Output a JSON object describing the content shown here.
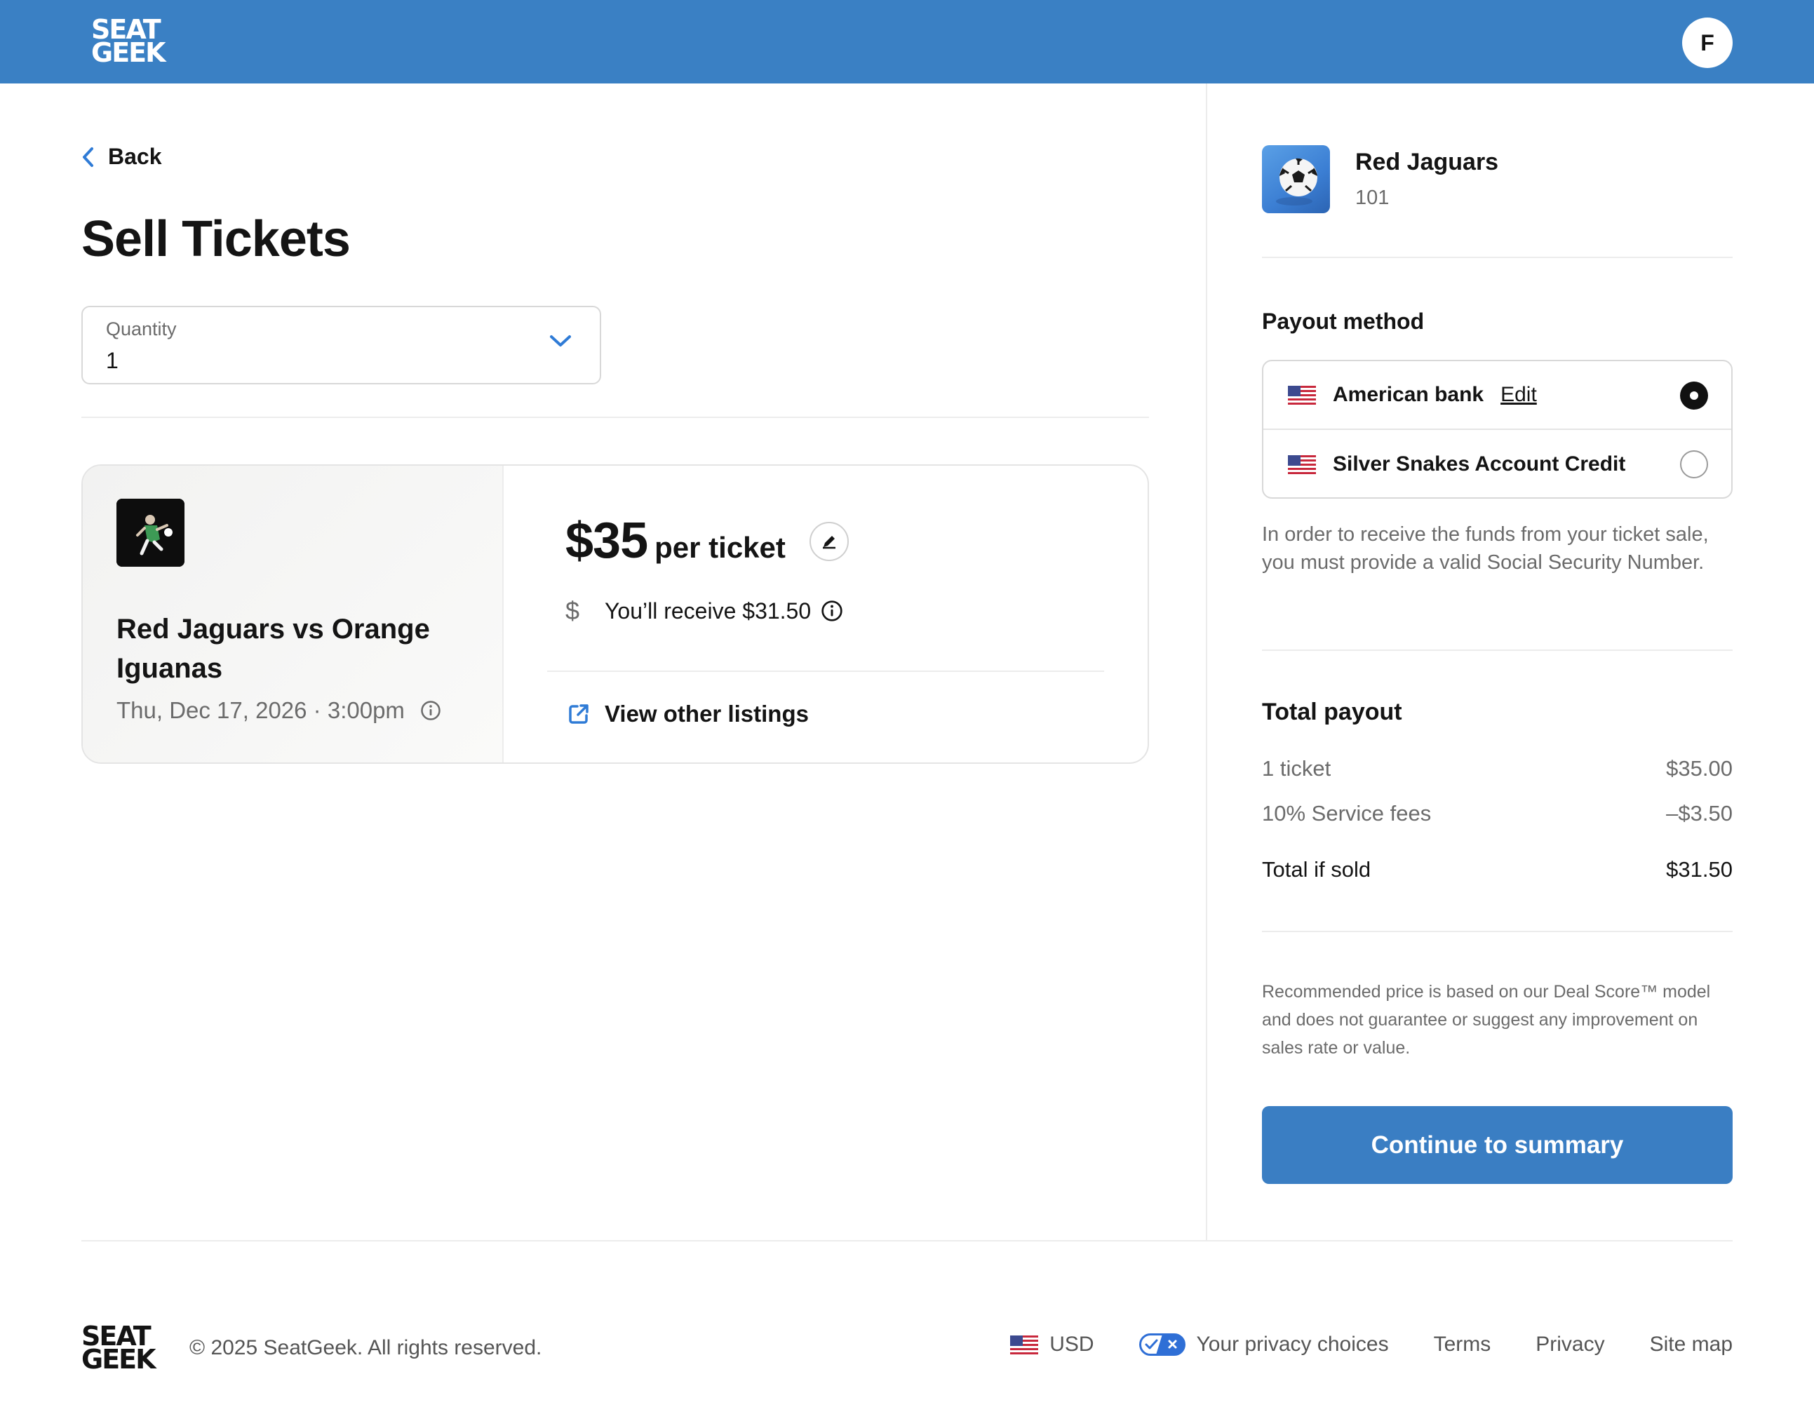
{
  "header": {
    "logo": "SEAT GEEK",
    "avatar_initial": "F"
  },
  "main": {
    "back_label": "Back",
    "title": "Sell Tickets",
    "quantity": {
      "label": "Quantity",
      "value": "1"
    },
    "event": {
      "title": "Red Jaguars vs Orange Iguanas",
      "date": "Thu, Dec 17, 2026 · 3:00pm"
    },
    "price": {
      "amount": "$35",
      "unit": "per ticket",
      "receive_text": "You’ll receive $31.50"
    },
    "view_other_listings": "View other listings"
  },
  "sidebar": {
    "team_name": "Red Jaguars",
    "section": "101",
    "payout_title": "Payout method",
    "payout_options": [
      {
        "label": "American bank",
        "edit_label": "Edit",
        "selected": true
      },
      {
        "label": "Silver Snakes Account Credit",
        "selected": false
      }
    ],
    "ssn_note": "In order to receive the funds from your ticket sale, you must provide a valid Social Security Number.",
    "total": {
      "title": "Total payout",
      "rows": [
        {
          "label": "1 ticket",
          "value": "$35.00"
        },
        {
          "label": "10% Service fees",
          "value": "–$3.50"
        },
        {
          "label": "Total if sold",
          "value": "$31.50"
        }
      ]
    },
    "disclaimer": "Recommended price is based on our Deal Score™ model and does not guarantee or suggest any improvement on sales rate or value.",
    "cta_label": "Continue to summary"
  },
  "footer": {
    "logo": "SEAT GEEK",
    "copyright": "© 2025 SeatGeek. All rights reserved.",
    "currency": "USD",
    "privacy_choices": "Your privacy choices",
    "terms": "Terms",
    "privacy": "Privacy",
    "site_map": "Site map"
  },
  "colors": {
    "brand_blue": "#3a80c4",
    "accent_blue": "#2f7bd6",
    "text_dark": "#141414",
    "text_muted": "#6b6b6b"
  },
  "icons": [
    "chevron-left-icon",
    "chevron-down-icon",
    "pencil-icon",
    "dollar-icon",
    "info-icon",
    "external-link-icon",
    "us-flag-icon",
    "privacy-toggle-icon",
    "soccer-ball-icon"
  ]
}
